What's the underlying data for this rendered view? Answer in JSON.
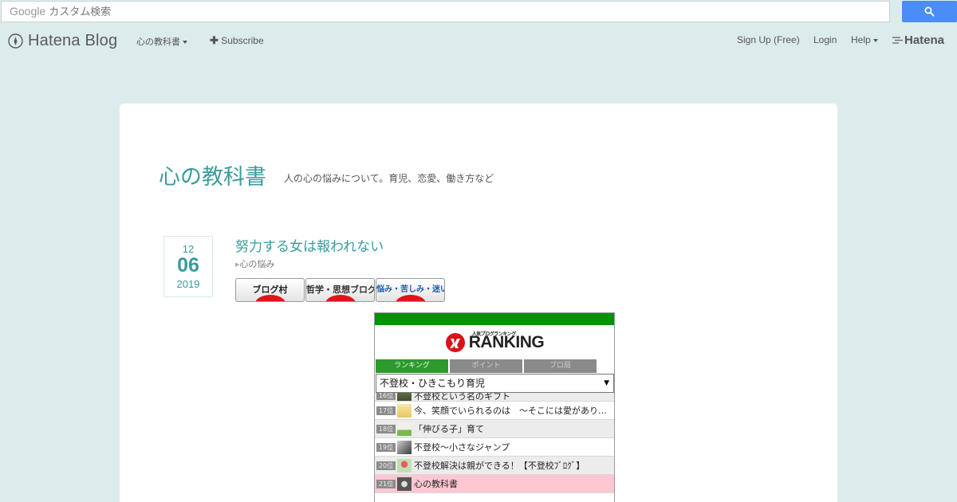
{
  "search": {
    "label": "Google",
    "placeholder": "カスタム検索"
  },
  "globalnav": {
    "brand": "Hatena Blog",
    "blog_menu": "心の教科書",
    "subscribe": "Subscribe",
    "signup": "Sign Up (Free)",
    "login": "Login",
    "help": "Help",
    "hatena": "Hatena"
  },
  "blog": {
    "title": "心の教科書",
    "description": "人の心の悩みについて。育児、恋愛、働き方など"
  },
  "entry": {
    "month": "12",
    "day": "06",
    "year": "2019",
    "title": "努力する女は報われない",
    "category": "心の悩み"
  },
  "banners": [
    {
      "label": "ブログ村",
      "small": "にほんブログ村"
    },
    {
      "label": "哲学・思想ブログ"
    },
    {
      "label": "悩み・苦しみ・迷い"
    }
  ],
  "ranking": {
    "logo_small": "人気ブログランキング",
    "logo": "RANKING",
    "tabs": [
      "ランキング",
      "ポイント",
      "プロ局"
    ],
    "category": "不登校・ひきこもり育児",
    "items": [
      {
        "rank": "16位",
        "name": "不登校という名のギフト"
      },
      {
        "rank": "17位",
        "name": "今、笑顔でいられるのは　〜そこには愛がありました〜"
      },
      {
        "rank": "18位",
        "name": "「伸びる子」育て"
      },
      {
        "rank": "19位",
        "name": "不登校〜小さなジャンプ"
      },
      {
        "rank": "20位",
        "name": "不登校解決は親ができる！【不登校ﾌﾞﾛｸﾞ】"
      },
      {
        "rank": "21位",
        "name": "心の教科書"
      }
    ]
  },
  "colors": {
    "accent": "#3a9c9c",
    "background": "#dcecec",
    "search_button": "#4c8cf5",
    "ranking_green": "#089108",
    "highlight_row": "#ffc7d2"
  }
}
